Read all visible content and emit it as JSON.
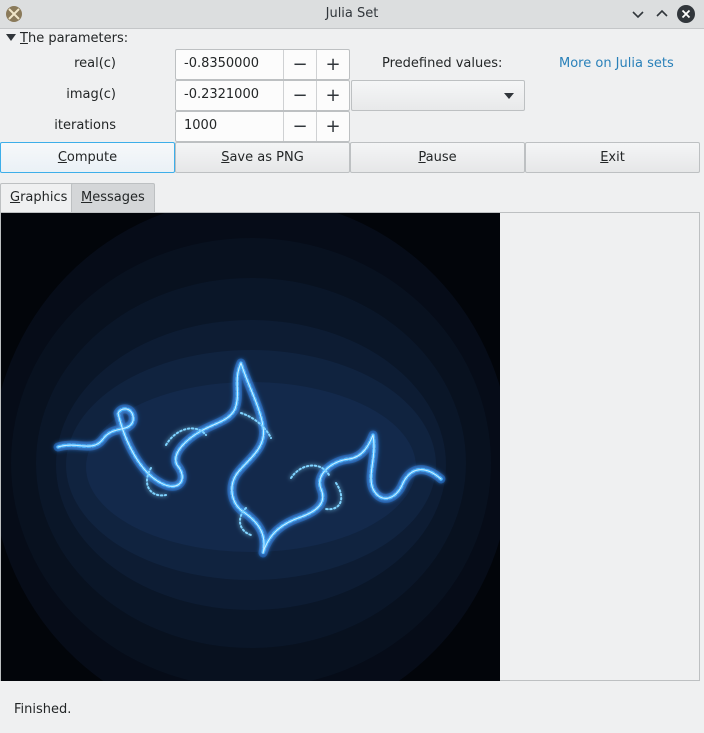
{
  "window": {
    "title": "Julia Set"
  },
  "params_header": {
    "mnemonic": "T",
    "rest": "he parameters:"
  },
  "params": [
    {
      "label": "real(c)",
      "value": "-0.8350000",
      "minus": "−",
      "plus": "+"
    },
    {
      "label": "imag(c)",
      "value": "-0.2321000",
      "minus": "−",
      "plus": "+"
    },
    {
      "label": "iterations",
      "value": "1000",
      "minus": "−",
      "plus": "+"
    }
  ],
  "predefined": {
    "label": "Predefined values:",
    "selected": ""
  },
  "link": "More on Julia sets",
  "buttons": {
    "compute": {
      "mn": "C",
      "rest": "ompute"
    },
    "save": {
      "mn": "S",
      "rest": "ave as PNG"
    },
    "pause": {
      "mn": "P",
      "rest": "ause"
    },
    "exit": {
      "mn": "E",
      "rest": "xit"
    }
  },
  "tabs": {
    "graphics": {
      "mn": "G",
      "rest": "raphics"
    },
    "messages": {
      "mn": "M",
      "rest": "essages"
    }
  },
  "status": "Finished.",
  "colors": {
    "accent": "#3daee9",
    "link": "#2980b9",
    "fractal": "#4db8ff",
    "canvas_bg": "#02050a"
  }
}
